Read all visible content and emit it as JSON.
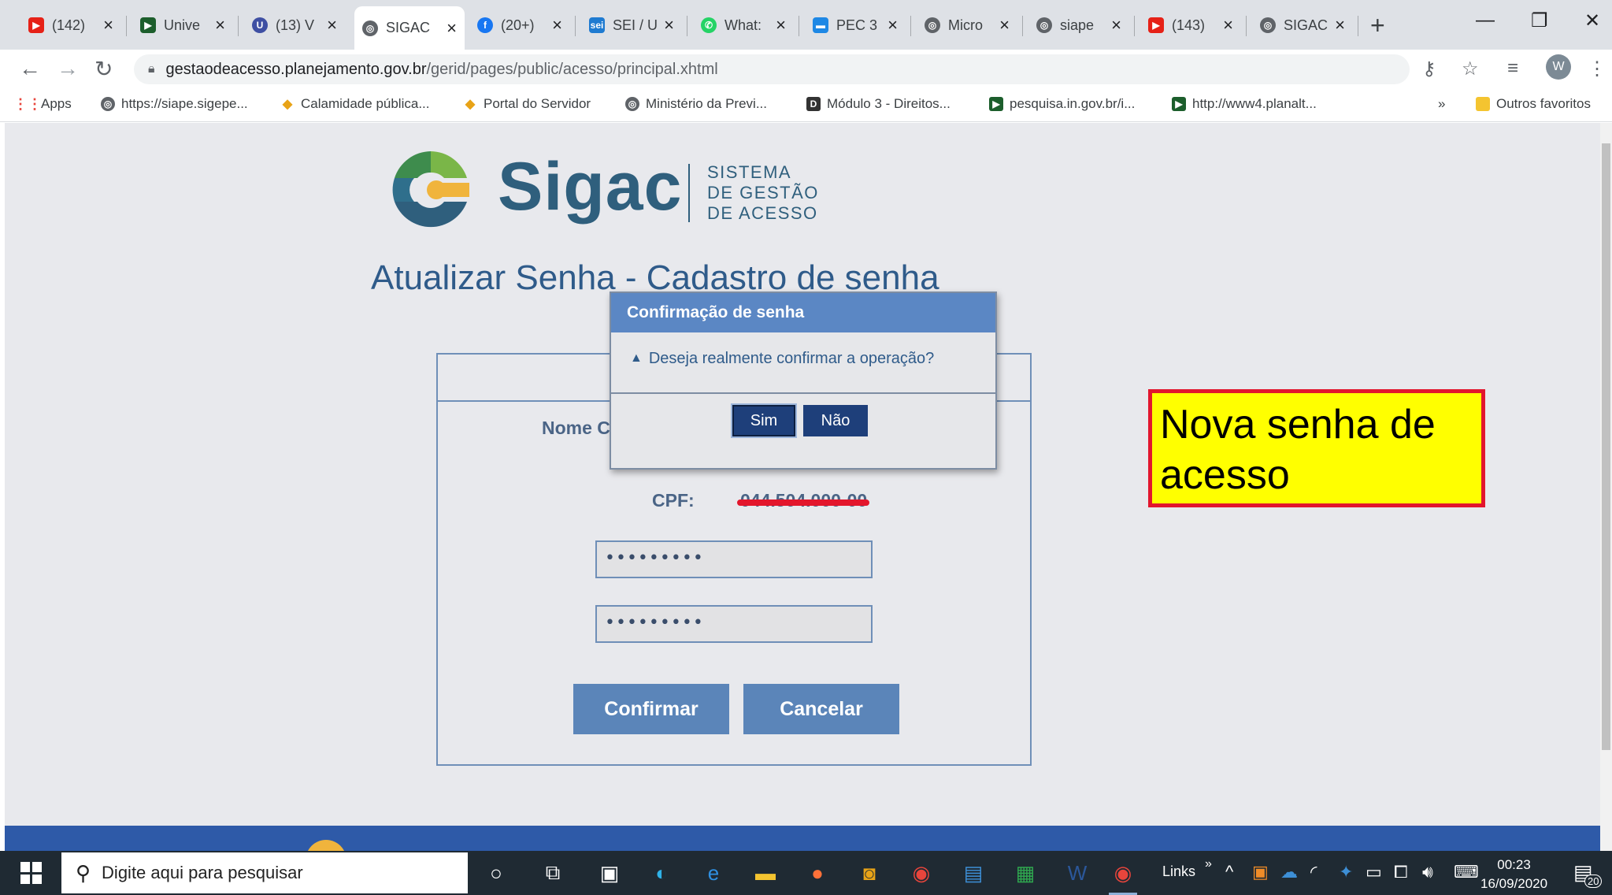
{
  "browser": {
    "tabs": [
      {
        "icon": "youtube-icon",
        "title": "(142)",
        "color": "#e62117"
      },
      {
        "icon": "gov-arrow-icon",
        "title": "Unive",
        "color": "#1c5e2c"
      },
      {
        "icon": "moodle-icon",
        "title": "(13) V",
        "color": "#3e4fa3"
      },
      {
        "icon": "globe-icon",
        "title": "SIGAC",
        "color": "#5f6368"
      },
      {
        "icon": "facebook-icon",
        "title": "(20+)",
        "color": "#1877f2"
      },
      {
        "icon": "sei-icon",
        "title": "SEI / U",
        "color": "#1f7bd1"
      },
      {
        "icon": "whatsapp-icon",
        "title": "What:",
        "color": "#25d366"
      },
      {
        "icon": "pec-icon",
        "title": "PEC 3",
        "color": "#1e88e5"
      },
      {
        "icon": "globe-icon",
        "title": "Micro",
        "color": "#5f6368"
      },
      {
        "icon": "globe-icon",
        "title": "siape",
        "color": "#5f6368"
      },
      {
        "icon": "youtube-icon",
        "title": "(143)",
        "color": "#e62117"
      },
      {
        "icon": "globe-icon",
        "title": "SIGAC",
        "color": "#5f6368"
      }
    ],
    "active_tab": 3,
    "url_domain": "gestaodeacesso.planejamento.gov.br",
    "url_path": "/gerid/pages/public/acesso/principal.xhtml",
    "profile_initial": "W",
    "bookmarks": [
      {
        "icon": "apps-grid-icon",
        "label": "Apps"
      },
      {
        "icon": "globe-icon",
        "label": "https://siape.sigepe..."
      },
      {
        "icon": "gov-diamond-icon",
        "label": "Calamidade pública..."
      },
      {
        "icon": "gov-diamond-icon",
        "label": "Portal do Servidor"
      },
      {
        "icon": "globe-icon",
        "label": "Ministério da Previ..."
      },
      {
        "icon": "d-logo-icon",
        "label": "Módulo 3 - Direitos..."
      },
      {
        "icon": "gov-arrow-icon",
        "label": "pesquisa.in.gov.br/i..."
      },
      {
        "icon": "gov-arrow-icon",
        "label": "http://www4.planalt..."
      }
    ],
    "bookmarks_overflow": "»",
    "other_bookmarks": "Outros favoritos"
  },
  "page": {
    "logo_word": "Sigac",
    "logo_sub_1": "SISTEMA",
    "logo_sub_2": "DE GESTÃO",
    "logo_sub_3": "DE ACESSO",
    "title": "Atualizar Senha - Cadastro de senha",
    "name_label": "Nome C",
    "cpf_label": "CPF:",
    "cpf_value": "044.504.000-00",
    "password_1": "•••••••••",
    "password_2": "•••••••••",
    "confirm_label": "Confirmar",
    "cancel_label": "Cancelar"
  },
  "dialog": {
    "title": "Confirmação de senha",
    "message": "Deseja realmente confirmar a operação?",
    "yes_label": "Sim",
    "no_label": "Não"
  },
  "annotation": {
    "text": "Nova senha de acesso",
    "background": "#ffff00",
    "border": "#e2162d"
  },
  "taskbar": {
    "search_placeholder": "Digite aqui para pesquisar",
    "links_label": "Links",
    "time": "00:23",
    "date": "16/09/2020",
    "notification_count": "20"
  }
}
